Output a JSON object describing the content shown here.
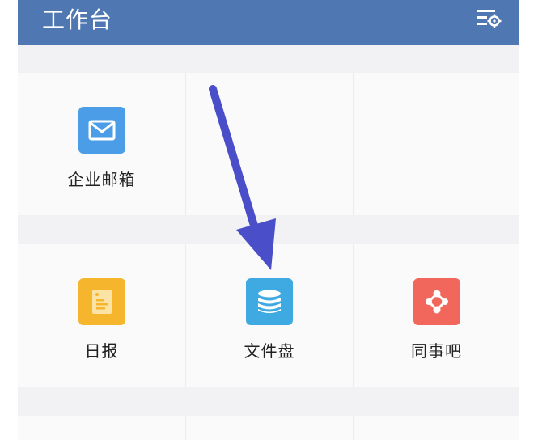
{
  "header": {
    "title": "工作台",
    "background": "#4f77b1",
    "settings_icon": "list-settings-icon"
  },
  "apps": [
    {
      "label": "企业邮箱",
      "icon": "mail-icon",
      "color": "#4a9de6"
    },
    {
      "label": "日报",
      "icon": "daily-report-icon",
      "color": "#f5b52d"
    },
    {
      "label": "文件盘",
      "icon": "database-icon",
      "color": "#3fa9e2"
    },
    {
      "label": "同事吧",
      "icon": "network-icon",
      "color": "#f2675b"
    }
  ],
  "annotation": {
    "arrow_color": "#4a4fc9"
  }
}
